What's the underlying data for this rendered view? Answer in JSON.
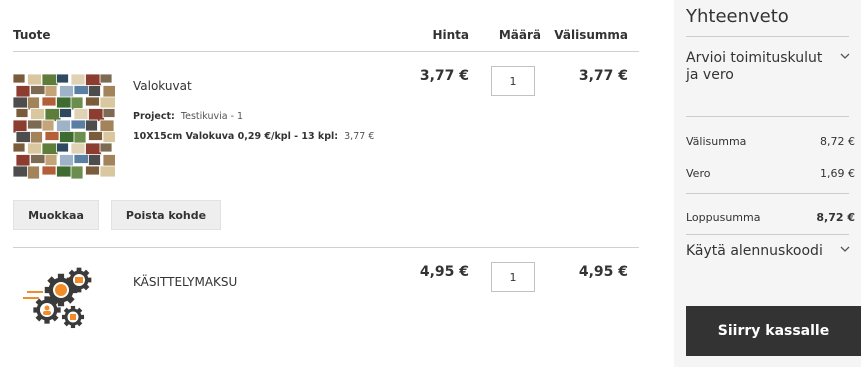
{
  "cart": {
    "headers": {
      "product": "Tuote",
      "price": "Hinta",
      "qty": "Määrä",
      "subtotal": "Välisumma"
    },
    "items": [
      {
        "name": "Valokuvat",
        "price": "3,77 €",
        "qty": "1",
        "subtotal": "3,77 €",
        "thumbnail_icon": "photo-collage-thumbnail",
        "options": [
          {
            "label": "Project:",
            "value": "Testikuvia - 1"
          },
          {
            "label": "10X15cm Valokuva 0,29 €/kpl - 13 kpl:",
            "value": "3,77 €"
          }
        ],
        "edit_label": "Muokkaa",
        "remove_label": "Poista kohde"
      },
      {
        "name": "KÄSITTELYMAKSU",
        "price": "4,95 €",
        "qty": "1",
        "subtotal": "4,95 €",
        "thumbnail_icon": "processing-gears-icon"
      }
    ]
  },
  "summary": {
    "title": "Yhteenveto",
    "shipping_estimate": "Arvioi toimituskulut ja vero",
    "totals": [
      {
        "label": "Välisumma",
        "value": "8,72 €"
      },
      {
        "label": "Vero",
        "value": "1,69 €"
      },
      {
        "label": "Loppusumma",
        "value": "8,72 €"
      }
    ],
    "discount": "Käytä alennuskoodi",
    "checkout_label": "Siirry kassalle"
  },
  "colors": {
    "text": "#333333",
    "summary_bg": "#f5f5f5",
    "checkout_bg": "#333333",
    "border": "#d1d1d1",
    "gear_orange": "#f28c28",
    "gear_dark": "#3a3a3a"
  }
}
